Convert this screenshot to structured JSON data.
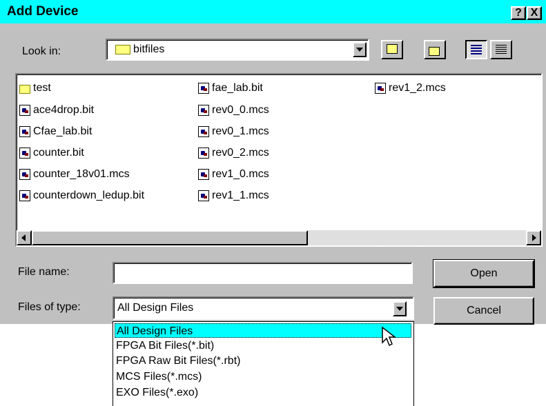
{
  "window": {
    "title": "Add Device",
    "help_btn": "?",
    "close_btn": "X"
  },
  "lookin": {
    "label": "Look in:",
    "value": "bitfiles",
    "folder_icon": "folder-icon"
  },
  "toolbar": {
    "icons": [
      "up-folder-icon",
      "new-folder-icon",
      "list-view-icon",
      "details-view-icon"
    ]
  },
  "files": {
    "col1": [
      "test",
      "ace4drop.bit",
      "Cfae_lab.bit",
      "counter.bit",
      "counter_18v01.mcs",
      "counterdown_ledup.bit"
    ],
    "col2": [
      "fae_lab.bit",
      "rev0_0.mcs",
      "rev0_1.mcs",
      "rev0_2.mcs",
      "rev1_0.mcs",
      "rev1_1.mcs"
    ],
    "col3": [
      "rev1_2.mcs"
    ]
  },
  "filename": {
    "label": "File name:",
    "value": ""
  },
  "filetype": {
    "label": "Files of type:",
    "value": "All Design Files",
    "options": [
      "All Design Files",
      "FPGA Bit Files(*.bit)",
      "FPGA Raw Bit Files(*.rbt)",
      "MCS Files(*.mcs)",
      "EXO Files(*.exo)"
    ]
  },
  "buttons": {
    "open": "Open",
    "cancel": "Cancel"
  },
  "colors": {
    "titlebar": "#00ffff",
    "face": "#c0c0c0",
    "selection": "#00ffff"
  }
}
